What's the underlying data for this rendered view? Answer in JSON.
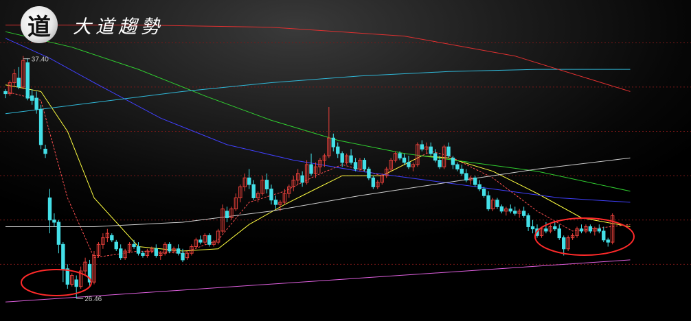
{
  "logo": {
    "seal_char": "道",
    "title": "大道趨勢"
  },
  "colors": {
    "up": "#e8403a",
    "down": "#44e0e8",
    "ma5": "#ff5050",
    "ma10": "#ffff40",
    "ma20": "#4040ff",
    "ma60": "#30d030",
    "ma120": "#d0d0d0",
    "ma250": "#30b8d8",
    "long_red": "#e03030",
    "trendline": "#e060e0",
    "circle": "#ff2a2a",
    "grid": "#7a1818"
  },
  "chart_data": {
    "type": "candlestick",
    "ylim": [
      26.0,
      39.0
    ],
    "annotations": {
      "high": {
        "label": "37.40",
        "value": 37.4,
        "bar": 4
      },
      "low": {
        "label": "26.46",
        "value": 26.46,
        "bar": 16
      }
    },
    "circled_regions": [
      "low",
      "right-bottom"
    ],
    "candles": [
      [
        35.8,
        35.9,
        35.5,
        35.7
      ],
      [
        35.7,
        36.3,
        35.6,
        36.2
      ],
      [
        36.2,
        36.8,
        36.0,
        36.6
      ],
      [
        36.4,
        36.9,
        35.9,
        36.0
      ],
      [
        36.0,
        37.4,
        35.9,
        37.2
      ],
      [
        37.1,
        37.3,
        35.4,
        35.5
      ],
      [
        35.6,
        35.9,
        35.2,
        35.4
      ],
      [
        35.5,
        35.8,
        34.8,
        35.0
      ],
      [
        35.0,
        35.2,
        33.2,
        33.4
      ],
      [
        33.2,
        33.4,
        32.8,
        33.0
      ],
      [
        31.0,
        31.4,
        29.4,
        30.0
      ],
      [
        30.0,
        30.3,
        29.7,
        29.9
      ],
      [
        29.9,
        30.0,
        28.5,
        28.9
      ],
      [
        28.9,
        29.0,
        27.2,
        27.8
      ],
      [
        27.8,
        28.0,
        26.9,
        27.1
      ],
      [
        27.1,
        27.6,
        27.0,
        27.5
      ],
      [
        27.3,
        27.5,
        26.46,
        27.0
      ],
      [
        27.0,
        27.9,
        26.9,
        27.7
      ],
      [
        27.7,
        28.3,
        27.5,
        28.1
      ],
      [
        28.0,
        28.2,
        27.0,
        27.2
      ],
      [
        27.2,
        28.6,
        27.1,
        28.4
      ],
      [
        28.4,
        29.0,
        28.3,
        28.9
      ],
      [
        28.9,
        29.4,
        28.7,
        29.2
      ],
      [
        29.2,
        29.6,
        29.0,
        29.4
      ],
      [
        29.3,
        29.4,
        29.0,
        29.1
      ],
      [
        29.0,
        29.1,
        28.6,
        28.7
      ],
      [
        28.7,
        28.9,
        28.2,
        28.3
      ],
      [
        28.3,
        28.7,
        28.2,
        28.6
      ],
      [
        28.6,
        29.0,
        28.5,
        28.9
      ],
      [
        28.9,
        29.1,
        28.7,
        28.8
      ],
      [
        28.8,
        29.0,
        28.4,
        28.5
      ],
      [
        28.5,
        28.6,
        28.3,
        28.4
      ],
      [
        28.4,
        28.7,
        28.3,
        28.6
      ],
      [
        28.6,
        28.8,
        28.5,
        28.7
      ],
      [
        28.7,
        28.9,
        28.3,
        28.4
      ],
      [
        28.4,
        28.6,
        28.2,
        28.5
      ],
      [
        28.5,
        29.0,
        28.4,
        28.9
      ],
      [
        28.9,
        29.0,
        28.5,
        28.6
      ],
      [
        28.6,
        28.8,
        28.5,
        28.7
      ],
      [
        28.7,
        28.9,
        28.4,
        28.5
      ],
      [
        28.5,
        28.7,
        28.1,
        28.2
      ],
      [
        28.3,
        28.6,
        28.2,
        28.5
      ],
      [
        28.5,
        28.9,
        28.4,
        28.8
      ],
      [
        28.8,
        29.2,
        28.7,
        29.1
      ],
      [
        29.1,
        29.3,
        28.9,
        29.0
      ],
      [
        29.0,
        29.4,
        28.9,
        29.3
      ],
      [
        29.3,
        29.4,
        28.8,
        28.9
      ],
      [
        28.9,
        29.1,
        28.8,
        29.0
      ],
      [
        29.0,
        29.6,
        28.9,
        29.5
      ],
      [
        29.5,
        30.7,
        29.4,
        30.5
      ],
      [
        30.4,
        30.6,
        29.9,
        30.1
      ],
      [
        30.1,
        30.6,
        30.0,
        30.5
      ],
      [
        30.5,
        31.2,
        30.4,
        31.0
      ],
      [
        31.0,
        31.6,
        30.8,
        31.5
      ],
      [
        31.5,
        32.1,
        31.3,
        31.9
      ],
      [
        31.9,
        32.3,
        31.4,
        31.6
      ],
      [
        31.6,
        31.8,
        30.9,
        31.0
      ],
      [
        31.0,
        31.3,
        30.8,
        31.2
      ],
      [
        31.2,
        32.0,
        31.1,
        31.8
      ],
      [
        31.8,
        32.1,
        31.2,
        31.4
      ],
      [
        31.4,
        31.6,
        30.7,
        30.9
      ],
      [
        30.9,
        31.1,
        30.5,
        30.7
      ],
      [
        30.7,
        30.9,
        30.4,
        30.8
      ],
      [
        30.8,
        31.4,
        30.7,
        31.2
      ],
      [
        31.2,
        31.6,
        31.0,
        31.5
      ],
      [
        31.5,
        32.0,
        31.3,
        31.8
      ],
      [
        31.8,
        32.3,
        31.6,
        32.1
      ],
      [
        32.0,
        32.2,
        31.5,
        31.7
      ],
      [
        31.7,
        32.7,
        31.6,
        32.5
      ],
      [
        32.5,
        33.0,
        32.0,
        32.1
      ],
      [
        32.1,
        32.6,
        31.9,
        32.4
      ],
      [
        32.4,
        32.8,
        32.1,
        32.7
      ],
      [
        32.7,
        33.0,
        32.4,
        32.9
      ],
      [
        32.9,
        35.1,
        32.8,
        33.7
      ],
      [
        33.7,
        33.9,
        33.1,
        33.3
      ],
      [
        33.3,
        33.5,
        32.8,
        33.0
      ],
      [
        33.0,
        33.1,
        32.4,
        32.6
      ],
      [
        32.6,
        33.0,
        32.5,
        32.9
      ],
      [
        32.9,
        33.2,
        32.5,
        32.6
      ],
      [
        32.6,
        32.8,
        32.2,
        32.3
      ],
      [
        32.3,
        32.8,
        32.2,
        32.7
      ],
      [
        32.7,
        32.8,
        32.2,
        32.3
      ],
      [
        32.3,
        32.4,
        31.8,
        31.9
      ],
      [
        31.9,
        32.0,
        31.4,
        31.5
      ],
      [
        31.5,
        31.8,
        31.4,
        31.7
      ],
      [
        31.7,
        32.1,
        31.6,
        32.0
      ],
      [
        32.0,
        32.4,
        31.9,
        32.3
      ],
      [
        32.3,
        32.8,
        32.2,
        32.7
      ],
      [
        32.7,
        33.1,
        32.6,
        33.0
      ],
      [
        33.0,
        33.1,
        32.7,
        32.8
      ],
      [
        32.8,
        33.0,
        32.5,
        32.6
      ],
      [
        32.6,
        32.9,
        32.3,
        32.4
      ],
      [
        32.4,
        32.6,
        32.2,
        32.5
      ],
      [
        32.5,
        33.5,
        32.4,
        33.4
      ],
      [
        33.4,
        33.6,
        33.1,
        33.2
      ],
      [
        33.2,
        33.5,
        33.0,
        33.3
      ],
      [
        33.3,
        33.5,
        32.9,
        33.0
      ],
      [
        33.0,
        33.2,
        32.6,
        32.7
      ],
      [
        32.7,
        32.9,
        32.3,
        32.4
      ],
      [
        32.4,
        33.4,
        32.3,
        33.3
      ],
      [
        33.3,
        33.5,
        32.8,
        32.9
      ],
      [
        32.8,
        32.9,
        32.3,
        32.5
      ],
      [
        32.5,
        32.6,
        32.2,
        32.3
      ],
      [
        32.3,
        32.5,
        32.0,
        32.1
      ],
      [
        32.1,
        32.3,
        31.7,
        31.8
      ],
      [
        31.8,
        32.0,
        31.6,
        31.9
      ],
      [
        31.9,
        32.0,
        31.5,
        31.6
      ],
      [
        31.6,
        31.8,
        31.3,
        31.4
      ],
      [
        31.4,
        31.5,
        31.0,
        31.1
      ],
      [
        31.1,
        31.3,
        30.4,
        30.5
      ],
      [
        30.5,
        31.0,
        30.4,
        30.9
      ],
      [
        30.9,
        31.0,
        30.5,
        30.6
      ],
      [
        30.6,
        30.7,
        30.3,
        30.4
      ],
      [
        30.4,
        30.6,
        30.2,
        30.5
      ],
      [
        30.5,
        30.7,
        30.3,
        30.4
      ],
      [
        30.4,
        30.6,
        30.2,
        30.3
      ],
      [
        30.3,
        30.5,
        30.1,
        30.4
      ],
      [
        30.4,
        30.6,
        30.1,
        30.2
      ],
      [
        30.2,
        30.3,
        29.5,
        29.7
      ],
      [
        29.7,
        30.0,
        29.4,
        29.6
      ],
      [
        29.6,
        29.8,
        29.2,
        29.3
      ],
      [
        29.3,
        29.7,
        29.2,
        29.6
      ],
      [
        29.6,
        29.9,
        29.4,
        29.5
      ],
      [
        29.5,
        29.8,
        29.4,
        29.7
      ],
      [
        29.7,
        29.9,
        29.5,
        29.6
      ],
      [
        29.6,
        29.8,
        29.1,
        29.2
      ],
      [
        29.2,
        29.3,
        28.4,
        28.7
      ],
      [
        28.7,
        29.3,
        28.6,
        29.2
      ],
      [
        29.2,
        29.4,
        29.1,
        29.3
      ],
      [
        29.3,
        29.7,
        29.2,
        29.6
      ],
      [
        29.6,
        29.8,
        29.4,
        29.5
      ],
      [
        29.5,
        29.8,
        29.4,
        29.7
      ],
      [
        29.7,
        29.8,
        29.4,
        29.5
      ],
      [
        29.5,
        29.7,
        29.3,
        29.6
      ],
      [
        29.6,
        29.8,
        29.4,
        29.5
      ],
      [
        29.5,
        29.7,
        29.0,
        29.1
      ],
      [
        29.1,
        29.2,
        28.8,
        29.0
      ],
      [
        29.0,
        30.3,
        28.9,
        30.2
      ]
    ],
    "moving_averages": [
      {
        "key": "ma5",
        "pts": [
          [
            0,
            35.8
          ],
          [
            8,
            35.4
          ],
          [
            14,
            31.0
          ],
          [
            20,
            28.3
          ],
          [
            30,
            28.6
          ],
          [
            40,
            28.5
          ],
          [
            48,
            29.1
          ],
          [
            55,
            30.8
          ],
          [
            63,
            31.3
          ],
          [
            70,
            32.0
          ],
          [
            76,
            32.5
          ],
          [
            85,
            32.0
          ],
          [
            96,
            33.1
          ],
          [
            100,
            32.9
          ],
          [
            110,
            31.9
          ],
          [
            120,
            30.4
          ],
          [
            128,
            29.5
          ],
          [
            141,
            29.8
          ]
        ]
      },
      {
        "key": "ma10",
        "pts": [
          [
            0,
            36.1
          ],
          [
            8,
            35.8
          ],
          [
            14,
            34.0
          ],
          [
            20,
            31.0
          ],
          [
            30,
            28.8
          ],
          [
            40,
            28.6
          ],
          [
            48,
            28.7
          ],
          [
            55,
            29.8
          ],
          [
            63,
            30.7
          ],
          [
            70,
            31.4
          ],
          [
            76,
            32.0
          ],
          [
            85,
            32.0
          ],
          [
            94,
            32.9
          ],
          [
            100,
            32.8
          ],
          [
            110,
            32.2
          ],
          [
            120,
            31.2
          ],
          [
            130,
            30.1
          ],
          [
            141,
            29.7
          ]
        ]
      },
      {
        "key": "ma20",
        "pts": [
          [
            0,
            38.2
          ],
          [
            10,
            37.3
          ],
          [
            20,
            36.2
          ],
          [
            35,
            34.6
          ],
          [
            50,
            33.4
          ],
          [
            65,
            32.7
          ],
          [
            80,
            32.2
          ],
          [
            95,
            31.8
          ],
          [
            110,
            31.4
          ],
          [
            125,
            31.0
          ],
          [
            141,
            30.8
          ]
        ]
      },
      {
        "key": "ma60",
        "pts": [
          [
            0,
            38.5
          ],
          [
            15,
            37.8
          ],
          [
            30,
            36.8
          ],
          [
            45,
            35.6
          ],
          [
            60,
            34.5
          ],
          [
            75,
            33.6
          ],
          [
            90,
            33.0
          ],
          [
            105,
            32.6
          ],
          [
            120,
            32.2
          ],
          [
            141,
            31.3
          ]
        ]
      },
      {
        "key": "ma120",
        "pts": [
          [
            0,
            29.7
          ],
          [
            20,
            29.7
          ],
          [
            40,
            29.9
          ],
          [
            60,
            30.4
          ],
          [
            80,
            31.1
          ],
          [
            100,
            31.7
          ],
          [
            120,
            32.3
          ],
          [
            141,
            32.8
          ]
        ]
      },
      {
        "key": "ma250",
        "pts": [
          [
            0,
            34.8
          ],
          [
            20,
            35.3
          ],
          [
            40,
            35.8
          ],
          [
            60,
            36.2
          ],
          [
            80,
            36.5
          ],
          [
            100,
            36.7
          ],
          [
            120,
            36.8
          ],
          [
            141,
            36.8
          ]
        ]
      },
      {
        "key": "long_red",
        "pts": [
          [
            0,
            38.8
          ],
          [
            30,
            38.8
          ],
          [
            60,
            38.7
          ],
          [
            90,
            38.3
          ],
          [
            115,
            37.4
          ],
          [
            141,
            35.8
          ]
        ]
      },
      {
        "key": "trendline",
        "pts": [
          [
            0,
            26.3
          ],
          [
            141,
            28.2
          ]
        ]
      }
    ],
    "grid_values": [
      28.0,
      30.0,
      32.0,
      34.0,
      36.0,
      38.0
    ]
  }
}
